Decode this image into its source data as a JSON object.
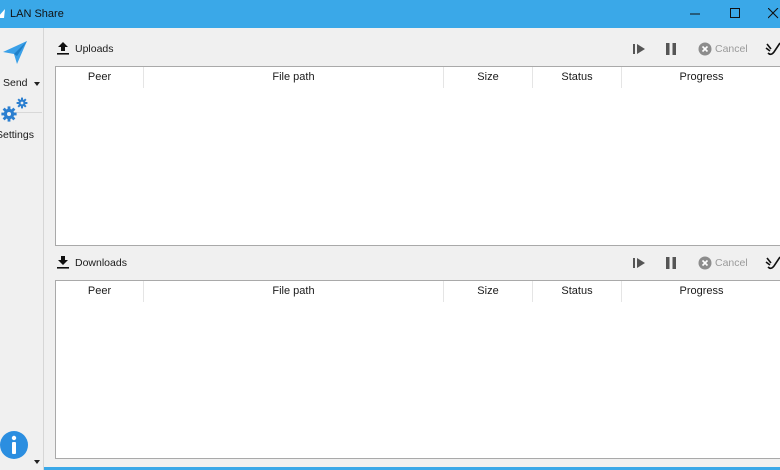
{
  "window": {
    "title": "LAN Share",
    "accent": "#3aa8e8",
    "icons": [
      "app-icon",
      "minimize-icon",
      "maximize-icon",
      "close-icon"
    ]
  },
  "sidebar": {
    "send": {
      "label": "Send",
      "icon": "paper-plane-icon"
    },
    "settings": {
      "label": "Settings",
      "icon": "gears-icon"
    },
    "info": {
      "icon": "info-icon"
    }
  },
  "uploads": {
    "title": "Uploads",
    "icon": "upload-icon",
    "toolbar": {
      "cancel_label": "Cancel"
    },
    "columns": [
      "Peer",
      "File path",
      "Size",
      "Status",
      "Progress"
    ],
    "rows": []
  },
  "downloads": {
    "title": "Downloads",
    "icon": "download-icon",
    "toolbar": {
      "cancel_label": "Cancel"
    },
    "columns": [
      "Peer",
      "File path",
      "Size",
      "Status",
      "Progress"
    ],
    "rows": []
  }
}
